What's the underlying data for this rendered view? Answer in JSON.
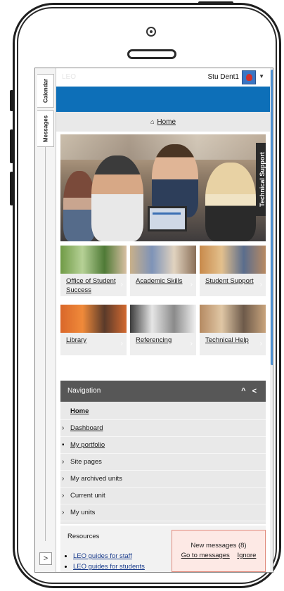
{
  "left_tabs": {
    "calendar": "Calendar",
    "messages": "Messages",
    "expand": ">"
  },
  "header": {
    "logo": "LEO",
    "user_name": "Stu Dent1",
    "caret": "▼"
  },
  "breadcrumb": {
    "home": "Home"
  },
  "hero": {
    "technical_support_tab": "Technical Support"
  },
  "tiles": [
    {
      "label": "Office of Student Success"
    },
    {
      "label": "Academic Skills"
    },
    {
      "label": "Student Support"
    },
    {
      "label": "Library"
    },
    {
      "label": "Referencing"
    },
    {
      "label": "Technical Help"
    }
  ],
  "navigation": {
    "title": "Navigation",
    "controls": "^ <",
    "items": [
      {
        "label": "Home"
      },
      {
        "label": "Dashboard"
      },
      {
        "label": "My portfolio"
      },
      {
        "label": "Site pages"
      },
      {
        "label": "My archived units"
      },
      {
        "label": "Current unit"
      },
      {
        "label": "My units"
      }
    ]
  },
  "resources": {
    "title": "Resources",
    "items": [
      "LEO guides for staff",
      "LEO guides for students"
    ]
  },
  "messages_popup": {
    "text": "New messages (8)",
    "go_link": "Go to messages",
    "ignore_link": "Ignore"
  },
  "colors": {
    "brand_blue": "#0d6fb8",
    "nav_header": "#575757",
    "popup_bg": "#fde9e5"
  }
}
